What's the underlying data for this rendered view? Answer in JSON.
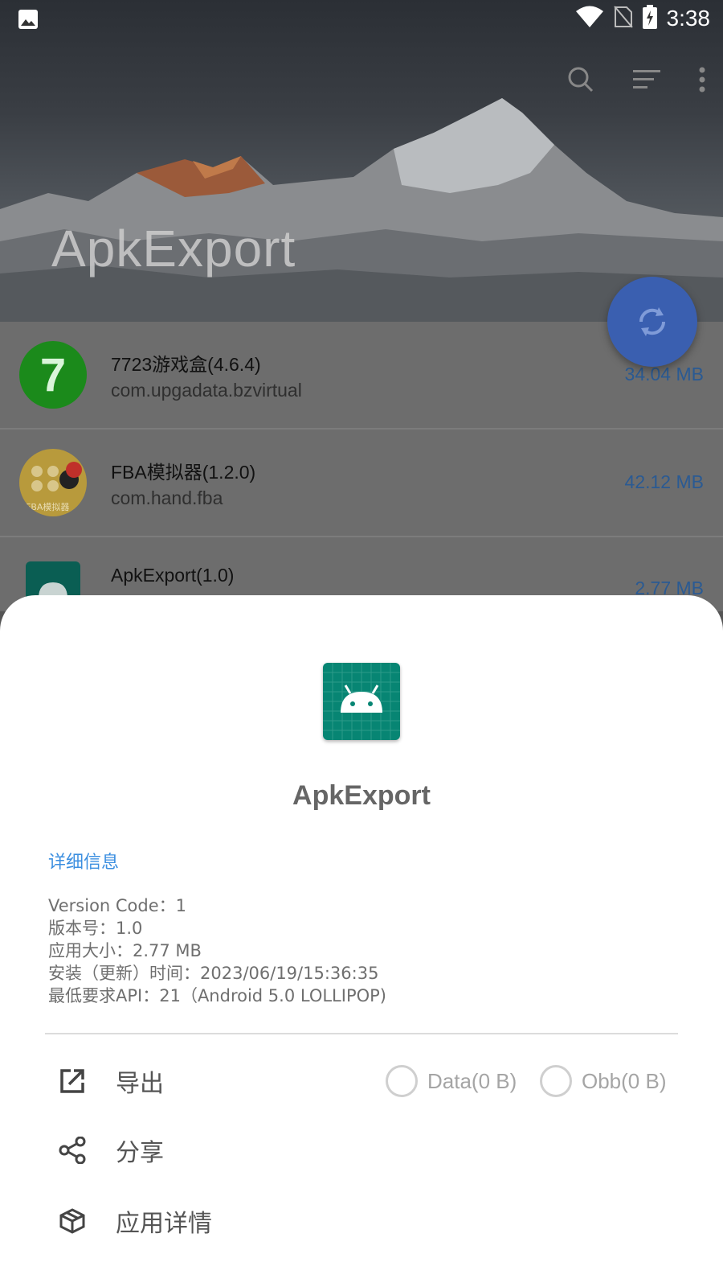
{
  "statusbar": {
    "time": "3:38"
  },
  "header": {
    "title": "ApkExport"
  },
  "app_list": [
    {
      "name": "7723游戏盒(4.6.4)",
      "package": "com.upgadata.bzvirtual",
      "size": "34.04 MB"
    },
    {
      "name": "FBA模拟器(1.2.0)",
      "package": "com.hand.fba",
      "size": "42.12 MB"
    },
    {
      "name": "ApkExport(1.0)",
      "package": "",
      "size": "2.77 MB"
    }
  ],
  "app_icons": {
    "first_icon_text": "7",
    "second_icon_text": "FBA模拟器"
  },
  "sheet": {
    "app_name": "ApkExport",
    "section_title": "详细信息",
    "details": [
      "Version Code：1",
      "版本号：1.0",
      "应用大小：2.77 MB",
      "安装（更新）时间：2023/06/19/15:36:35",
      "最低要求API：21（Android 5.0 LOLLIPOP)"
    ],
    "actions": {
      "export": "导出",
      "share": "分享",
      "app_details": "应用详情"
    },
    "options": {
      "data": "Data(0 B)",
      "obb": "Obb(0 B)"
    }
  },
  "colors": {
    "accent": "#3c8fe0",
    "fab": "#3a5fb0",
    "icon_teal": "#078573"
  }
}
